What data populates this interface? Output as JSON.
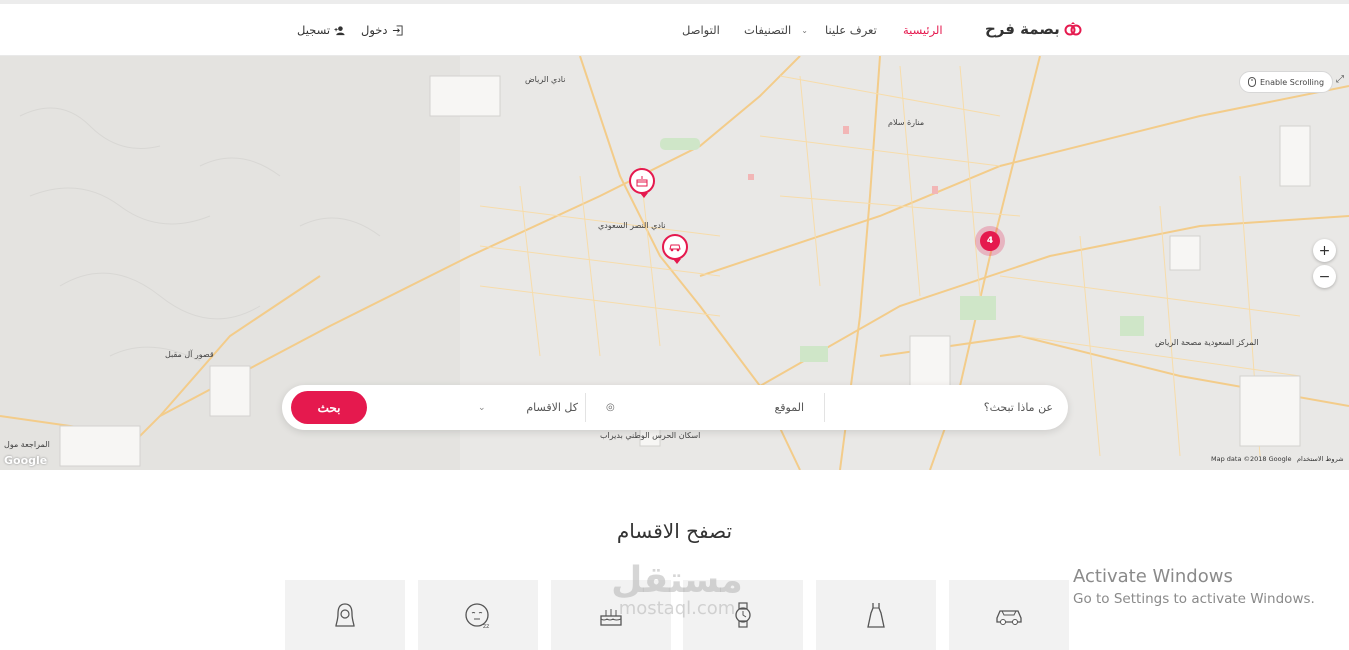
{
  "header": {
    "logo_text": "بصمة فرح",
    "nav": [
      {
        "label": "الرئيسية",
        "active": true
      },
      {
        "label": "تعرف علينا"
      },
      {
        "label": "التصنيفات",
        "has_dropdown": true
      },
      {
        "label": "التواصل"
      }
    ],
    "login_label": "دخول",
    "register_label": "تسجيل"
  },
  "map": {
    "enable_scrolling_label": "Enable Scrolling",
    "zoom_in": "+",
    "zoom_out": "−",
    "cluster_count": "4",
    "labels": {
      "riyadh_club": "نادي الرياض",
      "nasr_club": "نادي النصر السعودي",
      "qusur": "قصور آل مقبل",
      "manarat": "منارة سلام",
      "horse_club": "اسكان الحرس الوطني بديراب",
      "saudi_center": "المركز السعودية مصحة الرياض",
      "muraja": "المراجعة مول"
    },
    "google_label": "Google",
    "map_data": "Map data ©2018 Google",
    "terms": "شروط الاستخدام",
    "accent_color": "#e5194e"
  },
  "search": {
    "query_placeholder": "عن ماذا تبحث؟",
    "location_placeholder": "الموقع",
    "category_value": "كل الاقسام",
    "button_label": "بحث"
  },
  "categories": {
    "title": "تصفح الاقسام",
    "items": [
      {
        "icon": "woman-icon"
      },
      {
        "icon": "sleep-face-icon"
      },
      {
        "icon": "cake-icon"
      },
      {
        "icon": "watch-icon"
      },
      {
        "icon": "dress-icon"
      },
      {
        "icon": "car-icon"
      }
    ]
  },
  "watermark": {
    "arabic": "مستقل",
    "english": "mostaql.com"
  },
  "os_notice": {
    "line1": "Activate Windows",
    "line2": "Go to Settings to activate Windows."
  }
}
